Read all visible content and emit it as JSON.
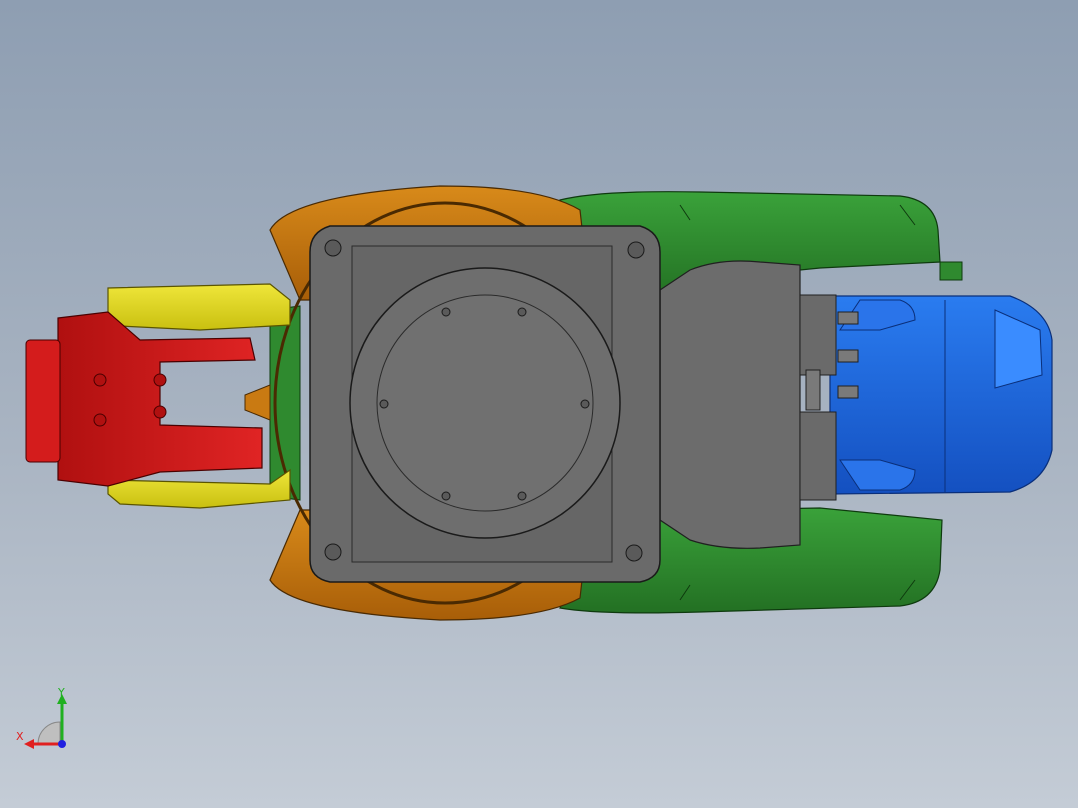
{
  "viewport": {
    "background_top": "#8e9eb2",
    "background_bottom": "#c4ccd6"
  },
  "model": {
    "description": "",
    "colors": {
      "housing_gray": "#6a6a6a",
      "orange": "#c97a12",
      "green": "#2f8a2f",
      "blue": "#1a63e0",
      "yellow": "#e0d81e",
      "red": "#d01818"
    }
  },
  "triad": {
    "x_label": "X",
    "y_label": "Y",
    "x_color": "#e02020",
    "y_color": "#20b020",
    "z_color": "#2020e0"
  }
}
